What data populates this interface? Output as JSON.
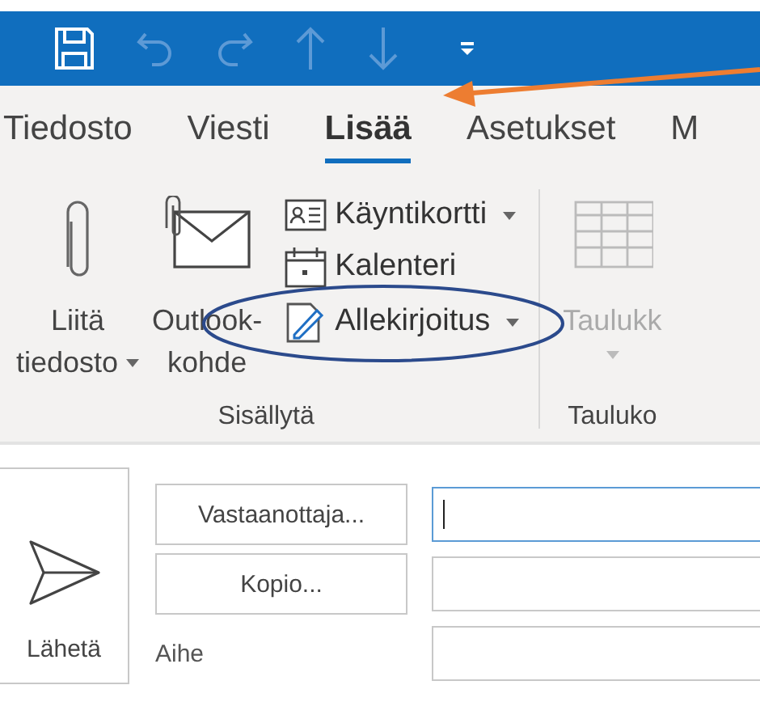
{
  "tabs": [
    {
      "label": "Tiedosto",
      "selected": false
    },
    {
      "label": "Viesti",
      "selected": false
    },
    {
      "label": "Lisää",
      "selected": true
    },
    {
      "label": "Asetukset",
      "selected": false
    },
    {
      "label": "M",
      "selected": false
    }
  ],
  "ribbon": {
    "groups": [
      {
        "label": "Sisällytä",
        "large_buttons": [
          {
            "kind": "attach",
            "lines": [
              "Liitä",
              "tiedosto"
            ],
            "dropdown": true
          },
          {
            "kind": "outlook-item",
            "lines": [
              "Outlook-",
              "kohde"
            ],
            "dropdown": false
          }
        ],
        "small_buttons": [
          {
            "kind": "business-card",
            "label": "Käyntikortti",
            "dropdown": true,
            "highlighted": false
          },
          {
            "kind": "calendar",
            "label": "Kalenteri",
            "dropdown": false,
            "highlighted": false
          },
          {
            "kind": "signature",
            "label": "Allekirjoitus",
            "dropdown": true,
            "highlighted": true
          }
        ]
      },
      {
        "label": "Tauluko",
        "large_buttons": [
          {
            "kind": "table",
            "lines": [
              "Taulukk"
            ],
            "dropdown": true,
            "disabled": true
          }
        ]
      }
    ]
  },
  "compose": {
    "send_button": "Lähetä",
    "recipients": [
      {
        "kind": "button",
        "label": "Vastaanottaja...",
        "focused": true
      },
      {
        "kind": "button",
        "label": "Kopio...",
        "focused": false
      },
      {
        "kind": "label",
        "label": "Aihe",
        "focused": false
      }
    ]
  }
}
